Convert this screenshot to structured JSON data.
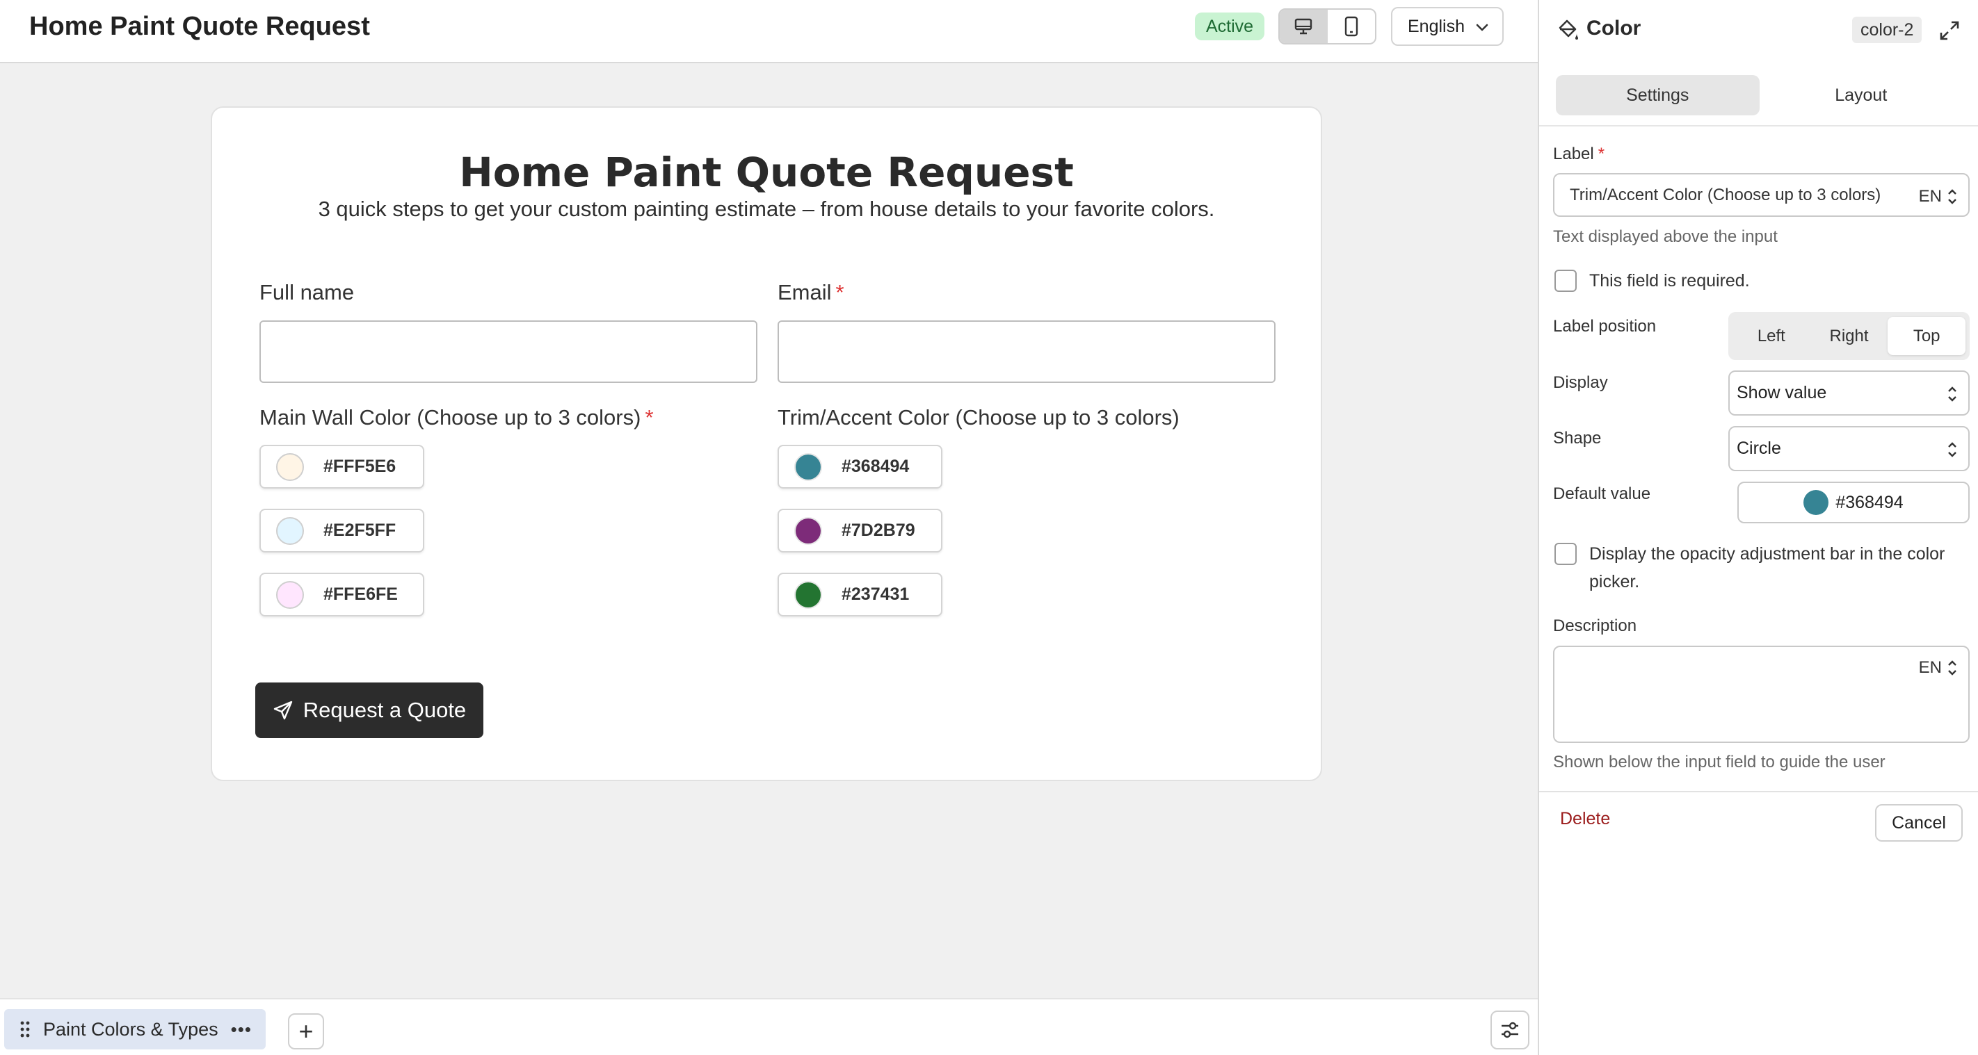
{
  "header": {
    "title": "Home Paint Quote Request",
    "status": "Active",
    "language": "English"
  },
  "form": {
    "title": "Home Paint Quote Request",
    "subtitle": "3 quick steps to get your custom painting estimate – from house details to your favorite colors.",
    "fields": {
      "full_name": {
        "label": "Full name",
        "value": ""
      },
      "email": {
        "label": "Email",
        "required_mark": "*",
        "value": ""
      }
    },
    "main_wall": {
      "label": "Main Wall Color (Choose up to 3 colors)",
      "required_mark": "*",
      "colors": [
        "#FFF5E6",
        "#E2F5FF",
        "#FFE6FE"
      ]
    },
    "trim": {
      "label": "Trim/Accent Color (Choose up to 3 colors)",
      "colors": [
        "#368494",
        "#7D2B79",
        "#237431"
      ]
    },
    "submit_label": "Request a Quote"
  },
  "pagebar": {
    "page_name": "Paint Colors & Types",
    "more": "•••",
    "add": "+"
  },
  "panel": {
    "title": "Color",
    "field_id": "color-2",
    "tabs": [
      "Settings",
      "Layout"
    ],
    "active_tab": "Settings",
    "label_field": {
      "label": "Label",
      "required_mark": "*",
      "value": "Trim/Accent Color (Choose up to 3 colors)",
      "lang": "EN",
      "help": "Text displayed above the input"
    },
    "required_checkbox": {
      "label": "This field is required.",
      "checked": false
    },
    "label_position": {
      "label": "Label position",
      "options": [
        "Left",
        "Right",
        "Top"
      ],
      "selected": "Top"
    },
    "display": {
      "label": "Display",
      "value": "Show value"
    },
    "shape": {
      "label": "Shape",
      "value": "Circle"
    },
    "default_value": {
      "label": "Default value",
      "value": "#368494"
    },
    "opacity_checkbox": {
      "line1": "Display the opacity adjustment bar in the color",
      "line2": "picker.",
      "checked": false
    },
    "description": {
      "label": "Description",
      "lang": "EN",
      "value": "",
      "help": "Shown below the input field to guide the user"
    },
    "delete_label": "Delete",
    "cancel_label": "Cancel"
  },
  "colors": {
    "brand_dark": "#2c2c2c",
    "status_bg": "#c9f3d2",
    "required": "#dd3333",
    "delete": "#9b1c1c"
  },
  "icons": {
    "paint_bucket": "paint-bucket-icon",
    "expand": "expand-icon",
    "desktop": "desktop-icon",
    "mobile": "mobile-icon",
    "send": "send-icon",
    "drag": "drag-handle-icon",
    "sliders": "sliders-icon"
  }
}
